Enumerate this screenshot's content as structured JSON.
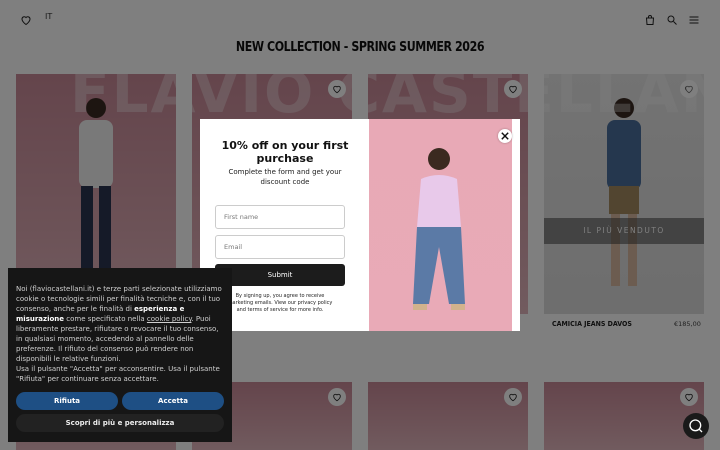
{
  "header": {
    "language": "IT",
    "icons": [
      "heart-icon",
      "bag-icon",
      "search-icon",
      "menu-icon"
    ]
  },
  "collection_title": "NEW COLLECTION - SPRING SUMMER 2026",
  "brand_watermark": "FLAVIO CASTELLANI",
  "products": [
    {
      "name": "",
      "price": ""
    },
    {
      "name": "",
      "price": ""
    },
    {
      "name": "",
      "price": ""
    },
    {
      "name": "CAMICIA JEANS DAVOS",
      "price": "€185,00",
      "badge": "IL PIÙ VENDUTO"
    }
  ],
  "popup": {
    "title": "10% off on your first purchase",
    "subtitle": "Complete the form and get your discount code",
    "first_name_placeholder": "First name",
    "email_placeholder": "Email",
    "submit_label": "Submit",
    "disclaimer": "By signing up, you agree to receive marketing emails. View our privacy policy and terms of service for more info."
  },
  "cookie": {
    "text_1": "Noi (flaviocastellani.it) e terze parti selezionate ",
    "text_2": "utilizziamo cookie o tecnologie simili per finalità tecniche e, con il tuo consenso, anche per le finalità di ",
    "bold_1": "esperienza e misurazione",
    "text_3": " come specificato nella ",
    "link": "cookie policy",
    "text_4": ". Puoi liberamente prestare, rifiutare o revocare il tuo consenso, in qualsiasi momento, accedendo al pannello delle preferenze. Il rifiuto del consenso può rendere non disponibili le relative funzioni.",
    "text_5": "Usa il pulsante \"Accetta\" per acconsentire. Usa il pulsante \"Rifiuta\" per continuare senza accettare.",
    "refuse_label": "Rifiuta",
    "accept_label": "Accetta",
    "more_label": "Scopri di più e personalizza"
  },
  "colors": {
    "overlay": "#000000",
    "accept_button": "#1e4f84",
    "submit_button": "#1c1c1c"
  }
}
